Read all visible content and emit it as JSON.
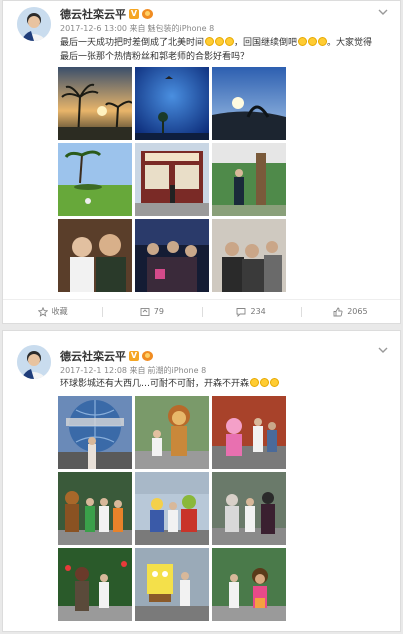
{
  "posts": [
    {
      "author": "德云社栾云平",
      "time": "2017-12-6 13:00",
      "source_prefix": "来自",
      "device": "魅包装的iPhone 8",
      "text_line1": "最后一天成功把时差倒成了北美时间",
      "text_line1b": "，回国继续倒吧",
      "text_line1c": "。大家觉得",
      "text_line2": "最后一张那个热情粉丝和郭老师的合影好看吗？",
      "actions": {
        "favorite": "收藏",
        "repost": "79",
        "comment": "234",
        "like": "2065"
      }
    },
    {
      "author": "德云社栾云平",
      "time": "2017-12-1 12:08",
      "source_prefix": "来自",
      "device": "前潮的iPhone 8",
      "text_line1": "环球影城还有大西几…可耐不可耐，开森不开森"
    }
  ],
  "colors": {
    "accent": "#f5a623",
    "card_bg": "#ffffff",
    "page_bg": "#e9e9e9"
  }
}
